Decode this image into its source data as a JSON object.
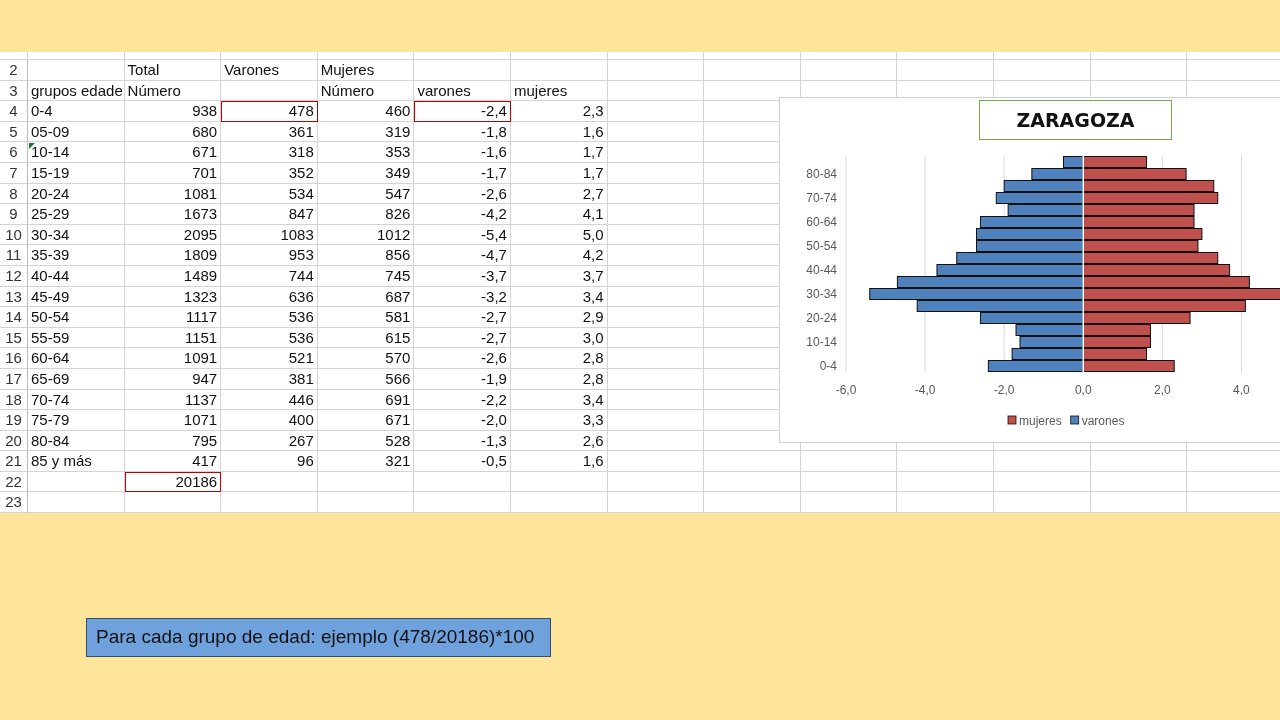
{
  "sheet": {
    "rows": [
      {
        "number": "2",
        "kind": "header",
        "first_cell_marker": false,
        "cells": [
          {
            "outlined": false
          },
          {
            "text": "Total",
            "outlined": false
          },
          {
            "text": "Varones",
            "outlined": false
          },
          {
            "text": "Mujeres",
            "outlined": false
          },
          {
            "outlined": false
          },
          {
            "outlined": false
          }
        ]
      },
      {
        "number": "3",
        "kind": "header",
        "first_cell_marker": false,
        "cells": [
          {
            "text": "grupos edade",
            "outlined": false
          },
          {
            "text": "Número",
            "outlined": false
          },
          {
            "outlined": false
          },
          {
            "text": "Número",
            "outlined": false
          },
          {
            "text": "varones",
            "outlined": false
          },
          {
            "text": "mujeres",
            "outlined": false
          }
        ]
      },
      {
        "number": "4",
        "kind": "data",
        "first_cell_marker": false,
        "cells": [
          {
            "text": "0-4",
            "outlined": false
          },
          {
            "text": "938",
            "outlined": false
          },
          {
            "text": "478",
            "outlined": true
          },
          {
            "text": "460",
            "outlined": false
          },
          {
            "text": "-2,4",
            "outlined": true
          },
          {
            "text": "2,3",
            "outlined": false
          }
        ]
      },
      {
        "number": "5",
        "kind": "data",
        "first_cell_marker": false,
        "cells": [
          {
            "text": "05-09",
            "outlined": false
          },
          {
            "text": "680",
            "outlined": false
          },
          {
            "text": "361",
            "outlined": false
          },
          {
            "text": "319",
            "outlined": false
          },
          {
            "text": "-1,8",
            "outlined": false
          },
          {
            "text": "1,6",
            "outlined": false
          }
        ]
      },
      {
        "number": "6",
        "kind": "data",
        "first_cell_marker": true,
        "cells": [
          {
            "text": "10-14",
            "outlined": false
          },
          {
            "text": "671",
            "outlined": false
          },
          {
            "text": "318",
            "outlined": false
          },
          {
            "text": "353",
            "outlined": false
          },
          {
            "text": "-1,6",
            "outlined": false
          },
          {
            "text": "1,7",
            "outlined": false
          }
        ]
      },
      {
        "number": "7",
        "kind": "data",
        "first_cell_marker": false,
        "cells": [
          {
            "text": "15-19",
            "outlined": false
          },
          {
            "text": "701",
            "outlined": false
          },
          {
            "text": "352",
            "outlined": false
          },
          {
            "text": "349",
            "outlined": false
          },
          {
            "text": "-1,7",
            "outlined": false
          },
          {
            "text": "1,7",
            "outlined": false
          }
        ]
      },
      {
        "number": "8",
        "kind": "data",
        "first_cell_marker": false,
        "cells": [
          {
            "text": "20-24",
            "outlined": false
          },
          {
            "text": "1081",
            "outlined": false
          },
          {
            "text": "534",
            "outlined": false
          },
          {
            "text": "547",
            "outlined": false
          },
          {
            "text": "-2,6",
            "outlined": false
          },
          {
            "text": "2,7",
            "outlined": false
          }
        ]
      },
      {
        "number": "9",
        "kind": "data",
        "first_cell_marker": false,
        "cells": [
          {
            "text": "25-29",
            "outlined": false
          },
          {
            "text": "1673",
            "outlined": false
          },
          {
            "text": "847",
            "outlined": false
          },
          {
            "text": "826",
            "outlined": false
          },
          {
            "text": "-4,2",
            "outlined": false
          },
          {
            "text": "4,1",
            "outlined": false
          }
        ]
      },
      {
        "number": "10",
        "kind": "data",
        "first_cell_marker": false,
        "cells": [
          {
            "text": "30-34",
            "outlined": false
          },
          {
            "text": "2095",
            "outlined": false
          },
          {
            "text": "1083",
            "outlined": false
          },
          {
            "text": "1012",
            "outlined": false
          },
          {
            "text": "-5,4",
            "outlined": false
          },
          {
            "text": "5,0",
            "outlined": false
          }
        ]
      },
      {
        "number": "11",
        "kind": "data",
        "first_cell_marker": false,
        "cells": [
          {
            "text": "35-39",
            "outlined": false
          },
          {
            "text": "1809",
            "outlined": false
          },
          {
            "text": "953",
            "outlined": false
          },
          {
            "text": "856",
            "outlined": false
          },
          {
            "text": "-4,7",
            "outlined": false
          },
          {
            "text": "4,2",
            "outlined": false
          }
        ]
      },
      {
        "number": "12",
        "kind": "data",
        "first_cell_marker": false,
        "cells": [
          {
            "text": "40-44",
            "outlined": false
          },
          {
            "text": "1489",
            "outlined": false
          },
          {
            "text": "744",
            "outlined": false
          },
          {
            "text": "745",
            "outlined": false
          },
          {
            "text": "-3,7",
            "outlined": false
          },
          {
            "text": "3,7",
            "outlined": false
          }
        ]
      },
      {
        "number": "13",
        "kind": "data",
        "first_cell_marker": false,
        "cells": [
          {
            "text": "45-49",
            "outlined": false
          },
          {
            "text": "1323",
            "outlined": false
          },
          {
            "text": "636",
            "outlined": false
          },
          {
            "text": "687",
            "outlined": false
          },
          {
            "text": "-3,2",
            "outlined": false
          },
          {
            "text": "3,4",
            "outlined": false
          }
        ]
      },
      {
        "number": "14",
        "kind": "data",
        "first_cell_marker": false,
        "cells": [
          {
            "text": "50-54",
            "outlined": false
          },
          {
            "text": "1117",
            "outlined": false
          },
          {
            "text": "536",
            "outlined": false
          },
          {
            "text": "581",
            "outlined": false
          },
          {
            "text": "-2,7",
            "outlined": false
          },
          {
            "text": "2,9",
            "outlined": false
          }
        ]
      },
      {
        "number": "15",
        "kind": "data",
        "first_cell_marker": false,
        "cells": [
          {
            "text": "55-59",
            "outlined": false
          },
          {
            "text": "1151",
            "outlined": false
          },
          {
            "text": "536",
            "outlined": false
          },
          {
            "text": "615",
            "outlined": false
          },
          {
            "text": "-2,7",
            "outlined": false
          },
          {
            "text": "3,0",
            "outlined": false
          }
        ]
      },
      {
        "number": "16",
        "kind": "data",
        "first_cell_marker": false,
        "cells": [
          {
            "text": "60-64",
            "outlined": false
          },
          {
            "text": "1091",
            "outlined": false
          },
          {
            "text": "521",
            "outlined": false
          },
          {
            "text": "570",
            "outlined": false
          },
          {
            "text": "-2,6",
            "outlined": false
          },
          {
            "text": "2,8",
            "outlined": false
          }
        ]
      },
      {
        "number": "17",
        "kind": "data",
        "first_cell_marker": false,
        "cells": [
          {
            "text": "65-69",
            "outlined": false
          },
          {
            "text": "947",
            "outlined": false
          },
          {
            "text": "381",
            "outlined": false
          },
          {
            "text": "566",
            "outlined": false
          },
          {
            "text": "-1,9",
            "outlined": false
          },
          {
            "text": "2,8",
            "outlined": false
          }
        ]
      },
      {
        "number": "18",
        "kind": "data",
        "first_cell_marker": false,
        "cells": [
          {
            "text": "70-74",
            "outlined": false
          },
          {
            "text": "1137",
            "outlined": false
          },
          {
            "text": "446",
            "outlined": false
          },
          {
            "text": "691",
            "outlined": false
          },
          {
            "text": "-2,2",
            "outlined": false
          },
          {
            "text": "3,4",
            "outlined": false
          }
        ]
      },
      {
        "number": "19",
        "kind": "data",
        "first_cell_marker": false,
        "cells": [
          {
            "text": "75-79",
            "outlined": false
          },
          {
            "text": "1071",
            "outlined": false
          },
          {
            "text": "400",
            "outlined": false
          },
          {
            "text": "671",
            "outlined": false
          },
          {
            "text": "-2,0",
            "outlined": false
          },
          {
            "text": "3,3",
            "outlined": false
          }
        ]
      },
      {
        "number": "20",
        "kind": "data",
        "first_cell_marker": false,
        "cells": [
          {
            "text": "80-84",
            "outlined": false
          },
          {
            "text": "795",
            "outlined": false
          },
          {
            "text": "267",
            "outlined": false
          },
          {
            "text": "528",
            "outlined": false
          },
          {
            "text": "-1,3",
            "outlined": false
          },
          {
            "text": "2,6",
            "outlined": false
          }
        ]
      },
      {
        "number": "21",
        "kind": "data",
        "first_cell_marker": false,
        "cells": [
          {
            "text": "85 y más",
            "outlined": false
          },
          {
            "text": "417",
            "outlined": false
          },
          {
            "text": "96",
            "outlined": false
          },
          {
            "text": "321",
            "outlined": false
          },
          {
            "text": "-0,5",
            "outlined": false
          },
          {
            "text": "1,6",
            "outlined": false
          }
        ]
      },
      {
        "number": "22",
        "kind": "data",
        "first_cell_marker": false,
        "cells": [
          {
            "outlined": false
          },
          {
            "text": "20186",
            "outlined": true
          },
          {
            "outlined": false
          },
          {
            "outlined": false
          },
          {
            "outlined": false
          },
          {
            "outlined": false
          }
        ]
      },
      {
        "number": "23",
        "kind": "data",
        "first_cell_marker": false,
        "cells": [
          {
            "outlined": false
          },
          {
            "outlined": false
          },
          {
            "outlined": false
          },
          {
            "outlined": false
          },
          {
            "outlined": false
          },
          {
            "outlined": false
          }
        ]
      }
    ]
  },
  "chart": {
    "title": "ZARAGOZA",
    "chart_data": {
      "type": "bar",
      "orientation": "horizontal",
      "stacked": true,
      "grid": true,
      "legend": true,
      "categories": [
        null,
        "80-84",
        null,
        "70-74",
        null,
        "60-64",
        null,
        "50-54",
        null,
        "40-44",
        null,
        "30-34",
        null,
        "20-24",
        null,
        "10-14",
        null,
        "0-4"
      ],
      "series": [
        {
          "name": "mujeres",
          "color": "#c0504d",
          "values": [
            1.6,
            2.6,
            3.3,
            3.4,
            2.8,
            2.8,
            3.0,
            2.9,
            3.4,
            3.7,
            4.2,
            5.0,
            4.1,
            2.7,
            1.7,
            1.7,
            1.6,
            2.3
          ]
        },
        {
          "name": "varones",
          "color": "#4f81bd",
          "values": [
            -0.5,
            -1.3,
            -2.0,
            -2.2,
            -1.9,
            -2.6,
            -2.7,
            -2.7,
            -3.2,
            -3.7,
            -4.7,
            -5.4,
            -4.2,
            -2.6,
            -1.7,
            -1.6,
            -1.8,
            -2.4
          ]
        }
      ],
      "xlim": [
        -6,
        5.0
      ],
      "xticks": [
        {
          "value": -6,
          "label": "-6,0"
        },
        {
          "value": -4,
          "label": "-4,0"
        },
        {
          "value": -2,
          "label": "-2,0"
        },
        {
          "value": 0,
          "label": "0,0"
        },
        {
          "value": 2,
          "label": "2,0"
        },
        {
          "value": 4,
          "label": "4,0"
        }
      ]
    }
  },
  "caption": "Para cada grupo de edad: ejemplo (478/20186)*100"
}
